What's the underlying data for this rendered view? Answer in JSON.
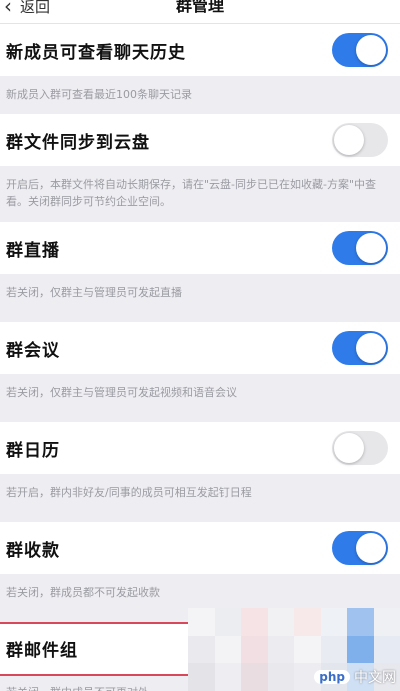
{
  "nav": {
    "back_label": "返回",
    "title": "群管理"
  },
  "settings": [
    {
      "label": "新成员可查看聊天历史",
      "on": true,
      "desc": "新成员入群可查看最近100条聊天记录"
    },
    {
      "label": "群文件同步到云盘",
      "on": false,
      "desc": "开启后，本群文件将自动长期保存，请在\"云盘-同步已已在如收藏-方案\"中查看。关闭群同步可节约企业空间。"
    },
    {
      "label": "群直播",
      "on": true,
      "desc": "若关闭，仅群主与管理员可发起直播"
    },
    {
      "label": "群会议",
      "on": true,
      "desc": "若关闭，仅群主与管理员可发起视频和语音会议"
    },
    {
      "label": "群日历",
      "on": false,
      "desc": "若开启，群内非好友/同事的成员可相互发起钉日程"
    },
    {
      "label": "群收款",
      "on": true,
      "desc": "若关闭，群成员都不可发起收款"
    },
    {
      "label": "群邮件组",
      "desc": "若关闭，群内成员不可再对外"
    }
  ],
  "watermark": {
    "brand": "php",
    "site": "中文网"
  },
  "colors": {
    "accent": "#2f7bea",
    "highlight": "#d9485a"
  }
}
